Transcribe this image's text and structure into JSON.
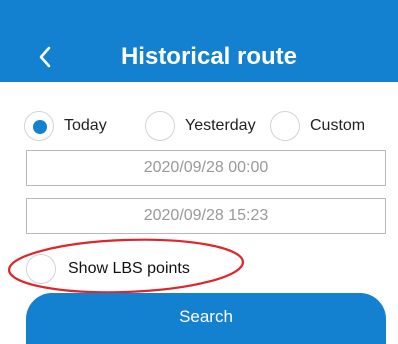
{
  "header": {
    "title": "Historical route",
    "back_icon": "chevron-left-icon"
  },
  "range_options": [
    {
      "label": "Today",
      "checked": true
    },
    {
      "label": "Yesterday",
      "checked": false
    },
    {
      "label": "Custom",
      "checked": false
    }
  ],
  "start_time": "2020/09/28 00:00",
  "end_time": "2020/09/28 15:23",
  "lbs": {
    "label": "Show LBS points",
    "checked": false
  },
  "search_label": "Search",
  "colors": {
    "accent": "#1381CF",
    "annotation": "#E0242B"
  }
}
